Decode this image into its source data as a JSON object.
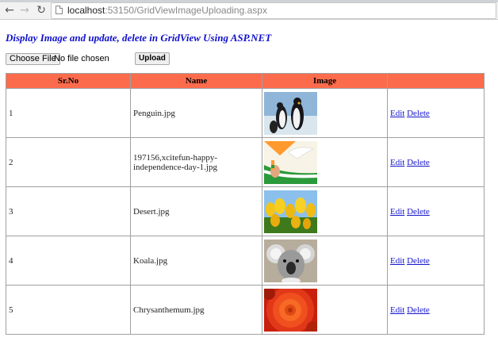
{
  "browser": {
    "url_host": "localhost",
    "url_path": ":53150/GridViewImageUploading.aspx"
  },
  "page": {
    "title": "Display Image and update, delete in GridView Using ASP.NET",
    "choose_file_label": "Choose File",
    "no_file_text": "No file chosen",
    "upload_label": "Upload"
  },
  "grid": {
    "headers": [
      "Sr.No",
      "Name",
      "Image",
      ""
    ],
    "rows": [
      {
        "sr": "1",
        "name": "Penguin.jpg",
        "image": "penguin-thumbnail",
        "edit": "Edit",
        "delete": "Delete"
      },
      {
        "sr": "2",
        "name": "197156,xcitefun-happy-independence-day-1.jpg",
        "image": "independence-day-thumbnail",
        "edit": "Edit",
        "delete": "Delete"
      },
      {
        "sr": "3",
        "name": "Desert.jpg",
        "image": "tulips-thumbnail",
        "edit": "Edit",
        "delete": "Delete"
      },
      {
        "sr": "4",
        "name": "Koala.jpg",
        "image": "koala-thumbnail",
        "edit": "Edit",
        "delete": "Delete"
      },
      {
        "sr": "5",
        "name": "Chrysanthemum.jpg",
        "image": "chrysanthemum-thumbnail",
        "edit": "Edit",
        "delete": "Delete"
      }
    ]
  },
  "colors": {
    "header_bg": "#fc6c4c",
    "title_color": "#1010cc",
    "link_color": "#1515cc"
  }
}
